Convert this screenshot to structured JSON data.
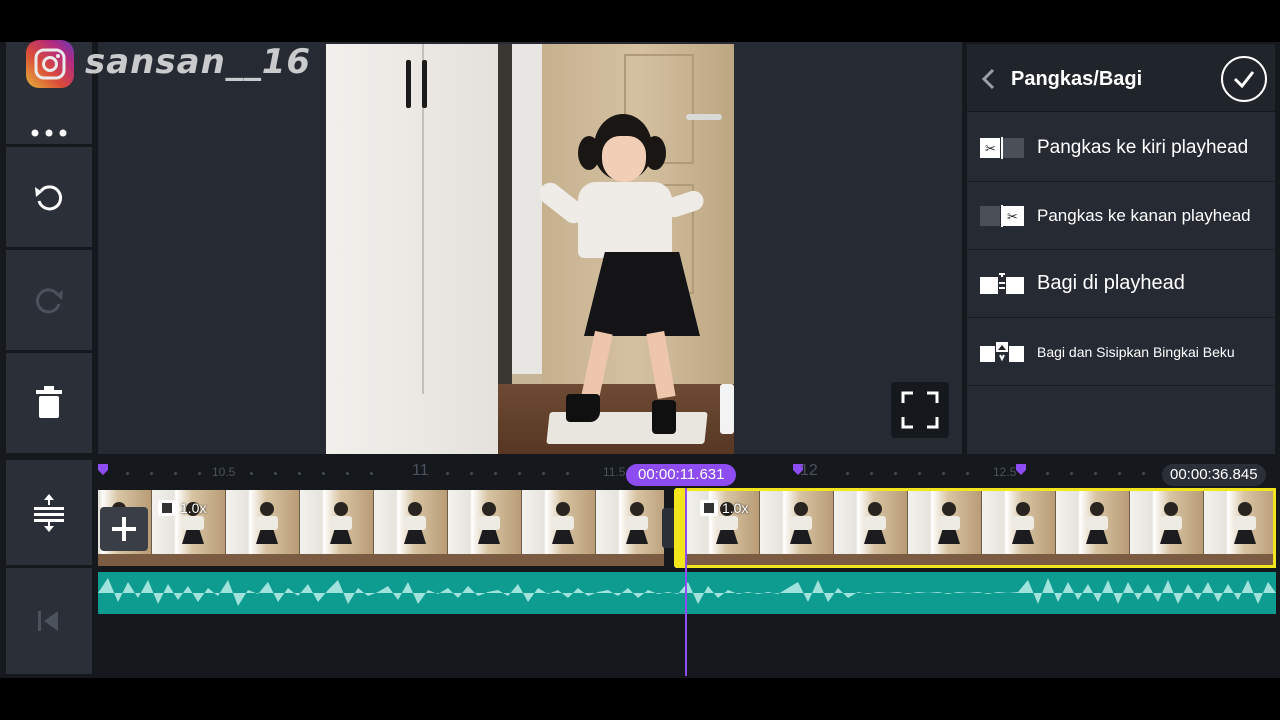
{
  "watermark": {
    "handle": "sansan__16"
  },
  "toolbar": {
    "items": [
      {
        "name": "more-icon"
      },
      {
        "name": "undo-icon"
      },
      {
        "name": "redo-icon"
      },
      {
        "name": "trash-icon"
      },
      {
        "name": "track-resize-icon"
      },
      {
        "name": "skip-to-start-icon"
      }
    ]
  },
  "panel": {
    "title": "Pangkas/Bagi",
    "items": [
      {
        "label": "Pangkas ke kiri playhead",
        "icon": "trim-left-icon"
      },
      {
        "label": "Pangkas ke kanan playhead",
        "icon": "trim-right-icon"
      },
      {
        "label": "Bagi di playhead",
        "icon": "split-icon"
      },
      {
        "label": "Bagi dan Sisipkan Bingkai Beku",
        "icon": "split-freeze-frame-icon"
      }
    ]
  },
  "timeline": {
    "current_time": "00:00:11.631",
    "total_time": "00:00:36.845",
    "ruler_labels": [
      "10.5",
      "11",
      "11.5",
      "12",
      "12.5"
    ],
    "clips": [
      {
        "speed": "1.0x"
      },
      {
        "speed": "1.0x"
      }
    ]
  },
  "colors": {
    "accent": "#8d4df2",
    "selection": "#f2e51b",
    "audio": "#0e9c90",
    "panel": "#252a33",
    "background": "#15181d"
  }
}
